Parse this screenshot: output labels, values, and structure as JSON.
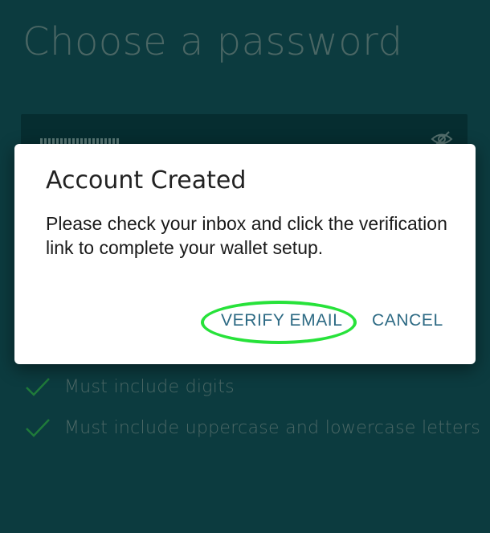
{
  "screen": {
    "title": "Choose a password",
    "requirements": [
      "Must include digits",
      "Must include uppercase and lowercase letters"
    ]
  },
  "dialog": {
    "title": "Account Created",
    "message": "Please check your inbox and click the verification link to complete your wallet setup.",
    "buttons": {
      "verify": "VERIFY EMAIL",
      "cancel": "CANCEL"
    }
  },
  "colors": {
    "background": "#0c3b3f",
    "accent_button": "#2d6a84",
    "check": "#1f7a3a",
    "highlight_ring": "#27e23a"
  },
  "icons": [
    "eye-slash-icon",
    "checkmark-icon"
  ]
}
